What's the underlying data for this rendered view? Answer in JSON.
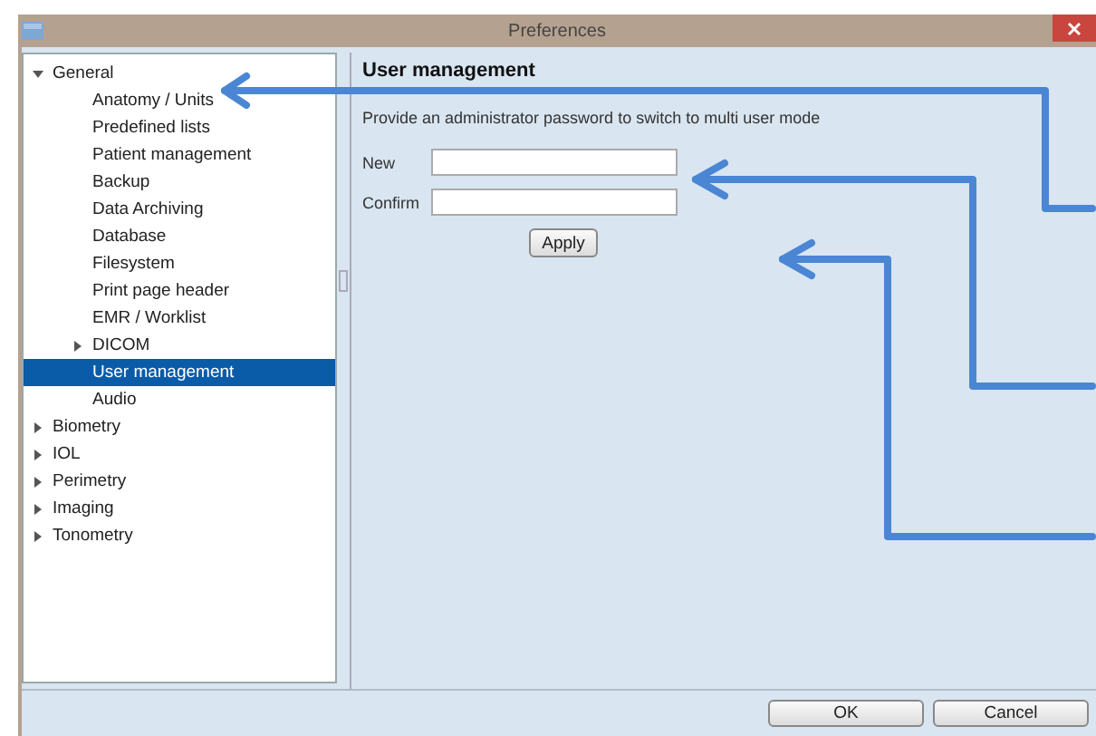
{
  "window": {
    "title": "Preferences"
  },
  "tree": [
    {
      "label": "General",
      "expanded": true,
      "selected": false,
      "children": [
        {
          "label": "Anatomy / Units",
          "selected": false
        },
        {
          "label": "Predefined lists",
          "selected": false
        },
        {
          "label": "Patient management",
          "selected": false
        },
        {
          "label": "Backup",
          "selected": false
        },
        {
          "label": "Data Archiving",
          "selected": false
        },
        {
          "label": "Database",
          "selected": false
        },
        {
          "label": "Filesystem",
          "selected": false
        },
        {
          "label": "Print page header",
          "selected": false
        },
        {
          "label": "EMR / Worklist",
          "selected": false
        },
        {
          "label": "DICOM",
          "expanded": false,
          "selected": false
        },
        {
          "label": "User management",
          "selected": true
        },
        {
          "label": "Audio",
          "selected": false
        }
      ]
    },
    {
      "label": "Biometry",
      "expanded": false,
      "selected": false
    },
    {
      "label": "IOL",
      "expanded": false,
      "selected": false
    },
    {
      "label": "Perimetry",
      "expanded": false,
      "selected": false
    },
    {
      "label": "Imaging",
      "expanded": false,
      "selected": false
    },
    {
      "label": "Tonometry",
      "expanded": false,
      "selected": false
    }
  ],
  "panel": {
    "title": "User management",
    "description": "Provide an administrator password to switch to multi user mode",
    "fields": [
      {
        "label": "New"
      },
      {
        "label": "Confirm"
      }
    ],
    "apply": "Apply"
  },
  "buttons": [
    "OK",
    "Cancel"
  ]
}
